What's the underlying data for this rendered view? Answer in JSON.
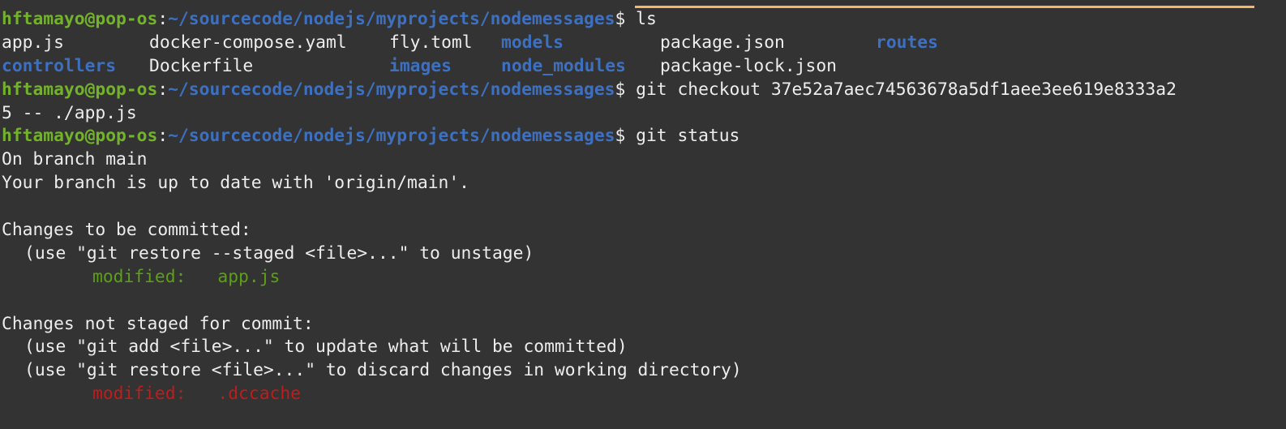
{
  "prompt": {
    "user": "hftamayo@pop-os",
    "sep": ":",
    "path": "~/sourcecode/nodejs/myprojects/nodemessages",
    "dollar": "$ "
  },
  "commands": {
    "ls": "ls",
    "checkout_part1": "git checkout 37e52a7aec74563678a5df1aee3ee619e8333a2",
    "checkout_part2": "5 -- ./app.js",
    "status": "git status"
  },
  "ls_output": {
    "row1": [
      "app.js",
      "docker-compose.yaml",
      "fly.toml",
      "models",
      "package.json",
      "routes"
    ],
    "row2": [
      "controllers",
      "Dockerfile",
      "images",
      "node_modules",
      "package-lock.json"
    ]
  },
  "status_output": {
    "branch": "On branch main",
    "up_to_date": "Your branch is up to date with 'origin/main'.",
    "staged_header": "Changes to be committed:",
    "staged_hint": "(use \"git restore --staged <file>...\" to unstage)",
    "staged_label": "modified:",
    "staged_file": "app.js",
    "unstaged_header": "Changes not staged for commit:",
    "unstaged_hint1": "(use \"git add <file>...\" to update what will be committed)",
    "unstaged_hint2": "(use \"git restore <file>...\" to discard changes in working directory)",
    "unstaged_label": "modified:",
    "unstaged_file": ".dccache"
  },
  "colors": {
    "background": "#333333",
    "foreground": "#ededed",
    "user_green": "#73b32a",
    "path_blue": "#3d70c0",
    "staged_green": "#5ba016",
    "unstaged_red": "#c01c1c",
    "accent_orange": "#f5b56a"
  }
}
